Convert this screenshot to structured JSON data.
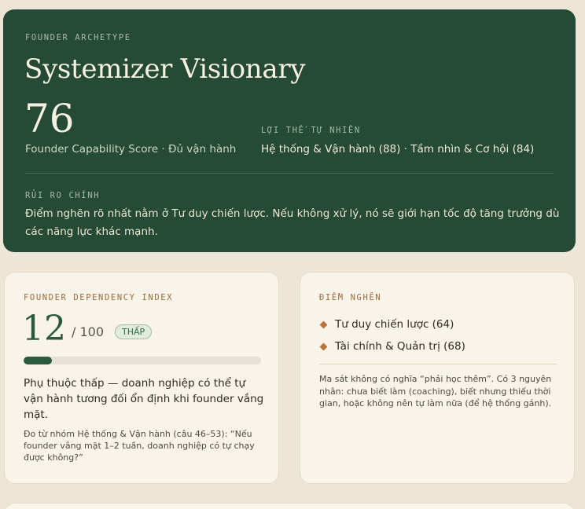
{
  "hero": {
    "eyebrow": "FOUNDER ARCHETYPE",
    "title": "Systemizer Visionary",
    "score": "76",
    "score_sub": "Founder Capability Score · Đủ vận hành",
    "strengths_label": "LỢI THẾ TỰ NHIÊN",
    "strengths": "Hệ thống & Vận hành (88) · Tầm nhìn & Cơ hội (84)",
    "risk_label": "RỦI RO CHÍNH",
    "risk_text": "Điểm nghẽn rõ nhất nằm ở Tư duy chiến lược. Nếu không xử lý, nó sẽ giới hạn tốc độ tăng trưởng dù các năng lực khác mạnh."
  },
  "dependency": {
    "eyebrow": "FOUNDER DEPENDENCY INDEX",
    "value": "12",
    "denominator": "/ 100",
    "badge": "THẤP",
    "fill_fraction": 0.12,
    "description": "Phụ thuộc thấp — doanh nghiệp có thể tự vận hành tương đối ổn định khi founder vắng mặt.",
    "note": "Đo từ nhóm Hệ thống & Vận hành (câu 46–53): “Nếu founder vắng mặt 1–2 tuần, doanh nghiệp có tự chạy được không?”"
  },
  "bottlenecks": {
    "eyebrow": "ĐIỂM NGHẼN",
    "items": [
      {
        "label": "Tư duy chiến lược (64)"
      },
      {
        "label": "Tài chính & Quản trị (68)"
      }
    ],
    "note": "Ma sát không có nghĩa “phải học thêm”. Có 3 nguyên nhân: chưa biết làm (coaching), biết nhưng thiếu thời gian, hoặc không nên tự làm nữa (để hệ thống gánh)."
  },
  "colors": {
    "hero_bg": "#254a35",
    "accent_green": "#2a5a3e",
    "accent_copper": "#b8743c",
    "page_bg": "#ede6d6"
  }
}
